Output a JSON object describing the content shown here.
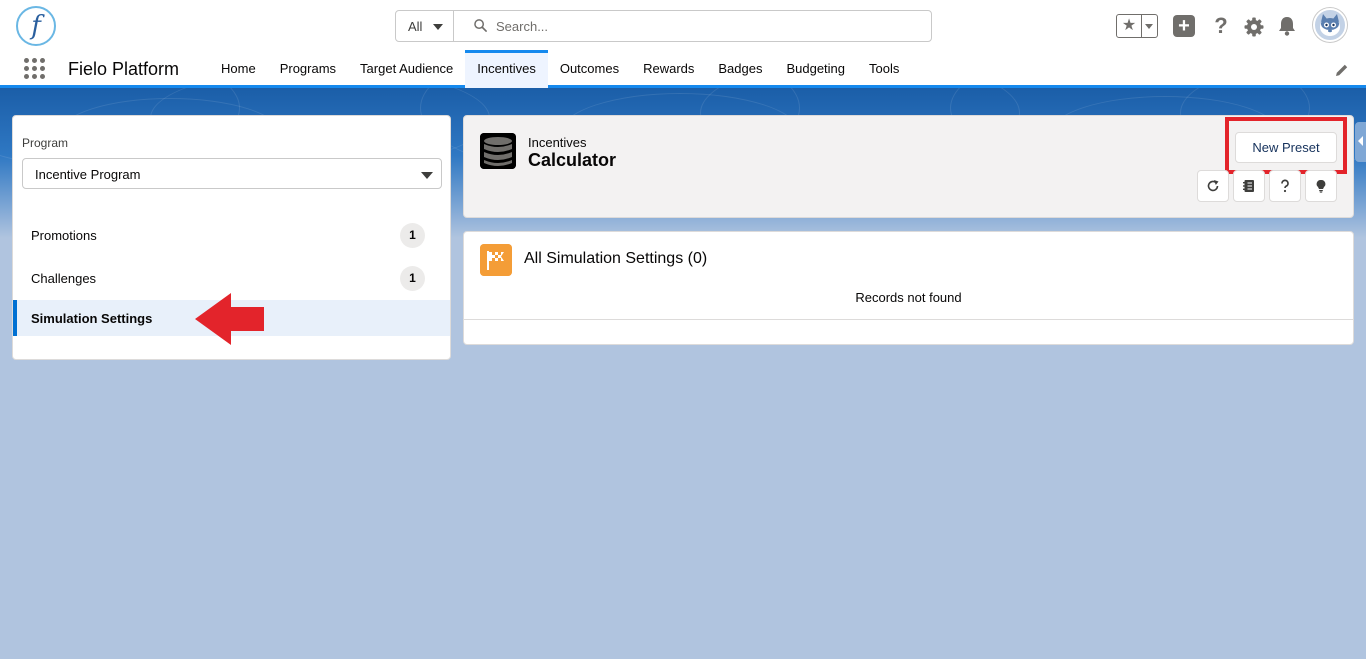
{
  "header": {
    "logo_letter": "f",
    "search_scope": "All",
    "search_placeholder": "Search..."
  },
  "nav": {
    "app_name": "Fielo Platform",
    "tabs": [
      {
        "label": "Home"
      },
      {
        "label": "Programs"
      },
      {
        "label": "Target Audience"
      },
      {
        "label": "Incentives",
        "active": true
      },
      {
        "label": "Outcomes"
      },
      {
        "label": "Rewards"
      },
      {
        "label": "Badges"
      },
      {
        "label": "Budgeting"
      },
      {
        "label": "Tools"
      }
    ]
  },
  "sidebar": {
    "program_label": "Program",
    "program_value": "Incentive Program",
    "items": [
      {
        "label": "Promotions",
        "count": "1"
      },
      {
        "label": "Challenges",
        "count": "1"
      },
      {
        "label": "Simulation Settings",
        "active": true
      }
    ]
  },
  "page_header": {
    "kicker": "Incentives",
    "title": "Calculator",
    "new_preset_label": "New Preset",
    "icon": "database-icon",
    "action_icons": [
      "refresh-icon",
      "notebook-icon",
      "help-icon",
      "lightbulb-icon"
    ]
  },
  "list": {
    "title": "All Simulation Settings (0)",
    "icon": "checkered-flag-icon",
    "empty_message": "Records not found"
  },
  "colors": {
    "brand_blue": "#1589ee",
    "highlight_red": "#e3242b",
    "list_icon_orange": "#f49d37",
    "background": "#b0c4df"
  }
}
